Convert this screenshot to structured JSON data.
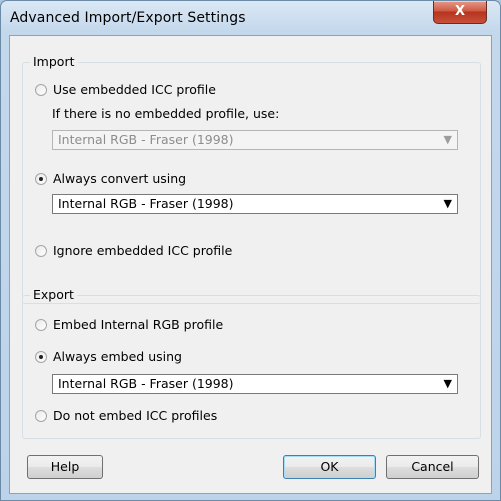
{
  "window": {
    "title": "Advanced Import/Export Settings",
    "close_label": "X"
  },
  "import": {
    "group_label": "Import",
    "use_embedded_label": "Use embedded ICC profile",
    "no_embedded_hint": "If there is no embedded profile, use:",
    "fallback_profile": "Internal RGB - Fraser (1998)",
    "always_convert_label": "Always convert using",
    "convert_profile": "Internal RGB - Fraser (1998)",
    "ignore_label": "Ignore embedded ICC profile",
    "selected": "always_convert"
  },
  "export": {
    "group_label": "Export",
    "embed_internal_label": "Embed Internal RGB profile",
    "always_embed_label": "Always embed using",
    "embed_profile": "Internal RGB - Fraser (1998)",
    "do_not_embed_label": "Do not embed ICC profiles",
    "selected": "always_embed"
  },
  "buttons": {
    "help": "Help",
    "ok": "OK",
    "cancel": "Cancel"
  },
  "icons": {
    "dropdown": "▼"
  }
}
